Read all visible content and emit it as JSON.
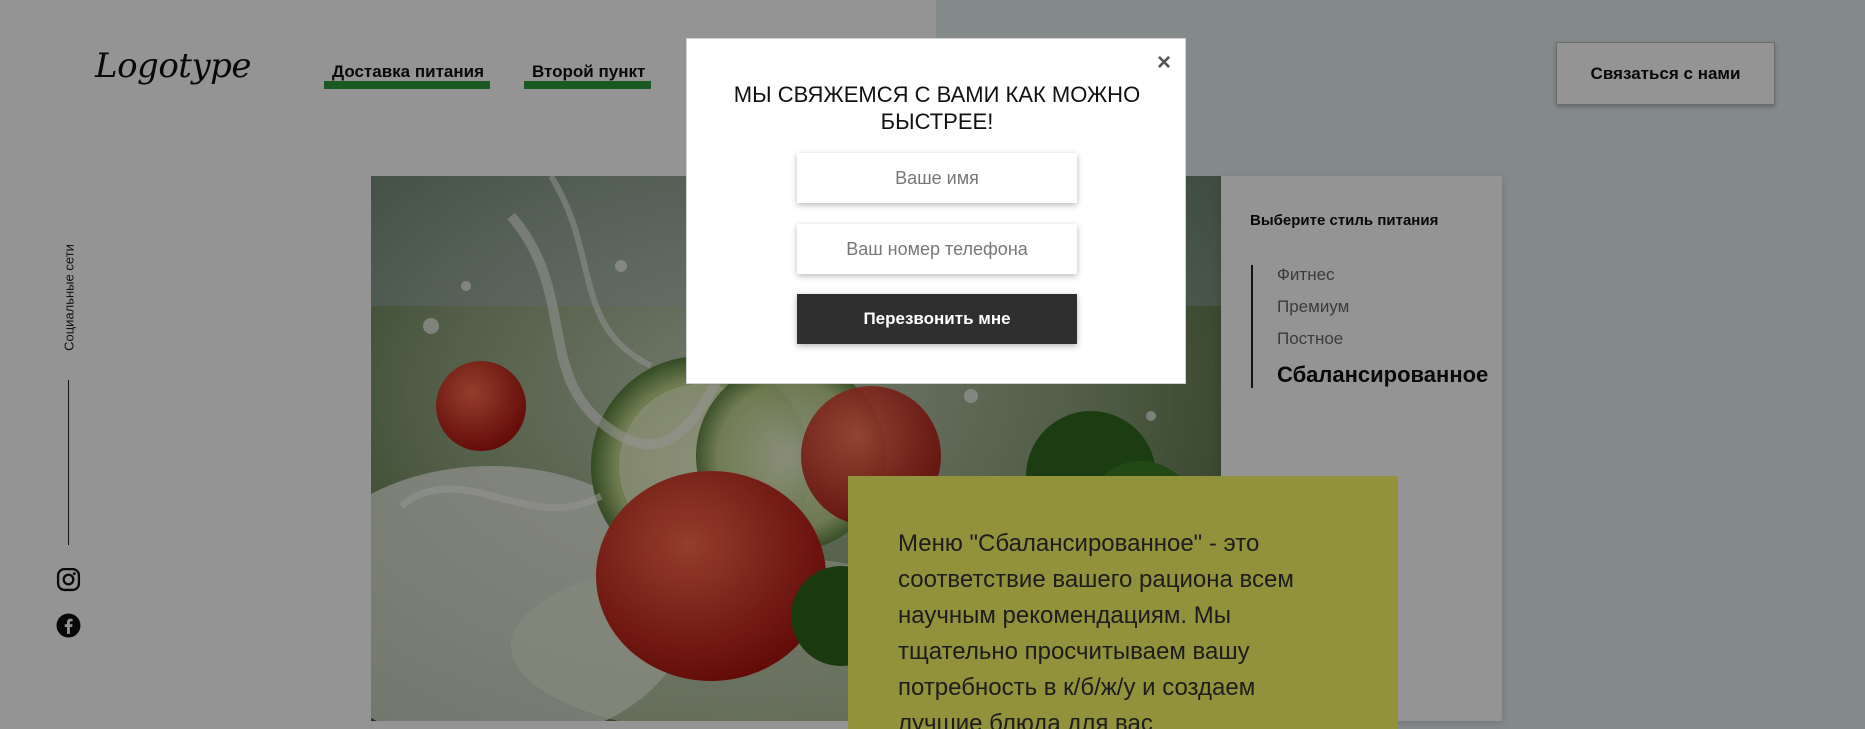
{
  "header": {
    "logo": "Logotype",
    "nav": [
      {
        "label": "Доставка питания"
      },
      {
        "label": "Второй пункт"
      }
    ],
    "contact_button": "Связаться с нами"
  },
  "social": {
    "label": "Социальные сети",
    "icons": [
      "instagram-icon",
      "facebook-icon"
    ]
  },
  "menu_panel": {
    "title": "Выберите стиль питания",
    "styles": [
      {
        "label": "Фитнес",
        "active": false
      },
      {
        "label": "Премиум",
        "active": false
      },
      {
        "label": "Постное",
        "active": false
      },
      {
        "label": "Сбалансированное",
        "active": true
      }
    ]
  },
  "description": {
    "text": "Меню \"Сбалансированное\" - это соответствие вашего рациона всем научным рекомендациям. Мы тщательно просчитываем вашу потребность в к/б/ж/у и создаем лучшие блюда для вас"
  },
  "modal": {
    "title": "МЫ СВЯЖЕМСЯ С ВАМИ КАК МОЖНО БЫСТРЕЕ!",
    "name_placeholder": "Ваше имя",
    "name_value": "",
    "phone_placeholder": "Ваш номер телефона",
    "phone_value": "",
    "submit_label": "Перезвонить мне",
    "close_symbol": "×"
  },
  "colors": {
    "accent_green": "#2e9c3c",
    "description_bg": "#fcfc6a",
    "button_dark": "#2f2f2f"
  }
}
